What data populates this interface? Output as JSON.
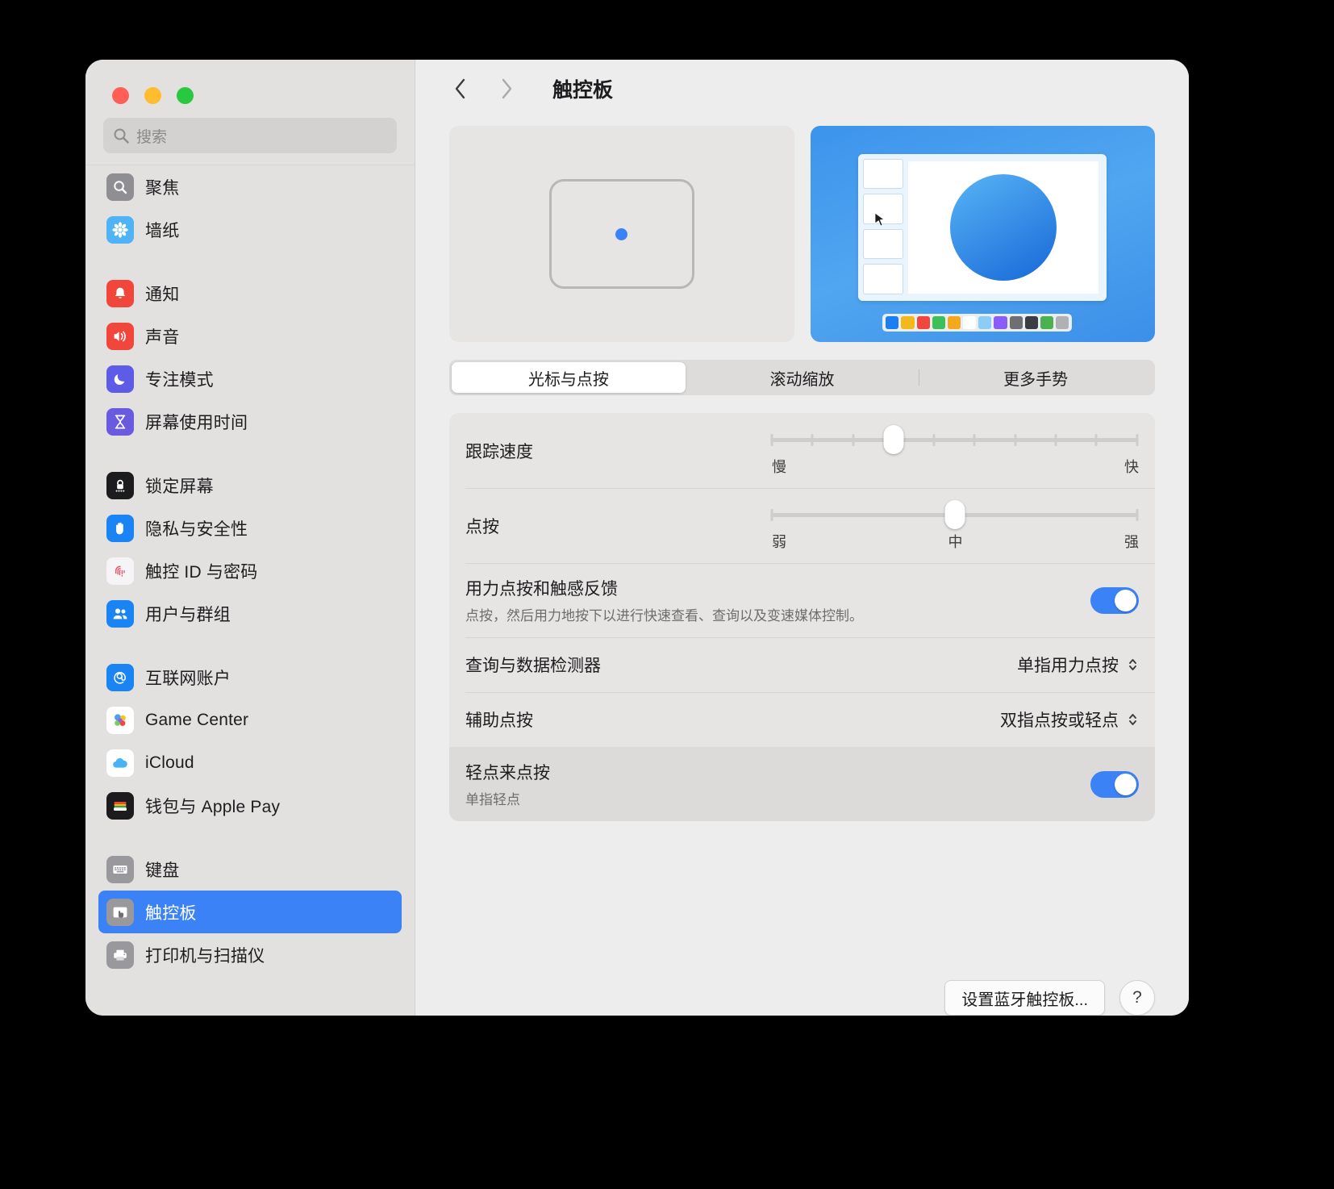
{
  "window": {
    "traffic_lights": [
      {
        "name": "close",
        "color": "#ff5f57"
      },
      {
        "name": "minimize",
        "color": "#febc2e"
      },
      {
        "name": "maximize",
        "color": "#28c840"
      }
    ]
  },
  "search": {
    "placeholder": "搜索",
    "value": ""
  },
  "sidebar": {
    "groups": [
      {
        "items": [
          {
            "label": "聚焦",
            "icon": "spotlight-icon",
            "color": "#8e8e93",
            "selected": false
          },
          {
            "label": "墙纸",
            "icon": "wallpaper-icon",
            "color": "#4fb3f5",
            "selected": false
          }
        ]
      },
      {
        "items": [
          {
            "label": "通知",
            "icon": "notifications-icon",
            "color": "#f0463c",
            "selected": false
          },
          {
            "label": "声音",
            "icon": "sound-icon",
            "color": "#f0463c",
            "selected": false
          },
          {
            "label": "专注模式",
            "icon": "focus-icon",
            "color": "#5e5ce6",
            "selected": false
          },
          {
            "label": "屏幕使用时间",
            "icon": "screentime-icon",
            "color": "#6a5ae0",
            "selected": false
          }
        ]
      },
      {
        "items": [
          {
            "label": "锁定屏幕",
            "icon": "lock-screen-icon",
            "color": "#1c1c1e",
            "selected": false
          },
          {
            "label": "隐私与安全性",
            "icon": "privacy-icon",
            "color": "#1a84f5",
            "selected": false
          },
          {
            "label": "触控 ID 与密码",
            "icon": "touchid-icon",
            "color": "#f5f5f7",
            "selected": false
          },
          {
            "label": "用户与群组",
            "icon": "users-icon",
            "color": "#1a84f5",
            "selected": false
          }
        ]
      },
      {
        "items": [
          {
            "label": "互联网账户",
            "icon": "internet-accounts-icon",
            "color": "#1a84f5",
            "selected": false
          },
          {
            "label": "Game Center",
            "icon": "game-center-icon",
            "color": "#ffffff",
            "selected": false
          },
          {
            "label": "iCloud",
            "icon": "icloud-icon",
            "color": "#ffffff",
            "selected": false
          },
          {
            "label": "钱包与 Apple Pay",
            "icon": "wallet-icon",
            "color": "#1c1c1e",
            "selected": false
          }
        ]
      },
      {
        "items": [
          {
            "label": "键盘",
            "icon": "keyboard-icon",
            "color": "#98989d",
            "selected": false
          },
          {
            "label": "触控板",
            "icon": "trackpad-icon",
            "color": "#98989d",
            "selected": true
          },
          {
            "label": "打印机与扫描仪",
            "icon": "printer-icon",
            "color": "#98989d",
            "selected": false
          }
        ]
      }
    ]
  },
  "toolbar": {
    "back_label": "返回",
    "forward_label": "前进",
    "title": "触控板"
  },
  "tabs": [
    {
      "label": "光标与点按",
      "active": true
    },
    {
      "label": "滚动缩放",
      "active": false
    },
    {
      "label": "更多手势",
      "active": false
    }
  ],
  "settings": {
    "tracking_speed": {
      "label": "跟踪速度",
      "min_label": "慢",
      "max_label": "快",
      "ticks": 10,
      "value_index": 3
    },
    "click": {
      "label": "点按",
      "min_label": "弱",
      "mid_label": "中",
      "max_label": "强",
      "ticks": 0,
      "value_percent": 50
    },
    "force_click": {
      "label": "用力点按和触感反馈",
      "sublabel": "点按，然后用力地按下以进行快速查看、查询以及变速媒体控制。",
      "toggle_on": true
    },
    "lookup": {
      "label": "查询与数据检测器",
      "value": "单指用力点按"
    },
    "secondary_click": {
      "label": "辅助点按",
      "value": "双指点按或轻点"
    },
    "tap_to_click": {
      "label": "轻点来点按",
      "sublabel": "单指轻点",
      "toggle_on": true
    }
  },
  "footer": {
    "bluetooth_button": "设置蓝牙触控板...",
    "help_button": "?"
  },
  "preview": {
    "palette_colors": [
      "#1e7ef0",
      "#f5b81c",
      "#f0463c",
      "#3fbf5a",
      "#f5a81c",
      "#ffffff",
      "#8ecbf7",
      "#8b5cf6",
      "#6e6e73",
      "#3c3c43",
      "#4caf50",
      "#b0b0b5"
    ]
  }
}
